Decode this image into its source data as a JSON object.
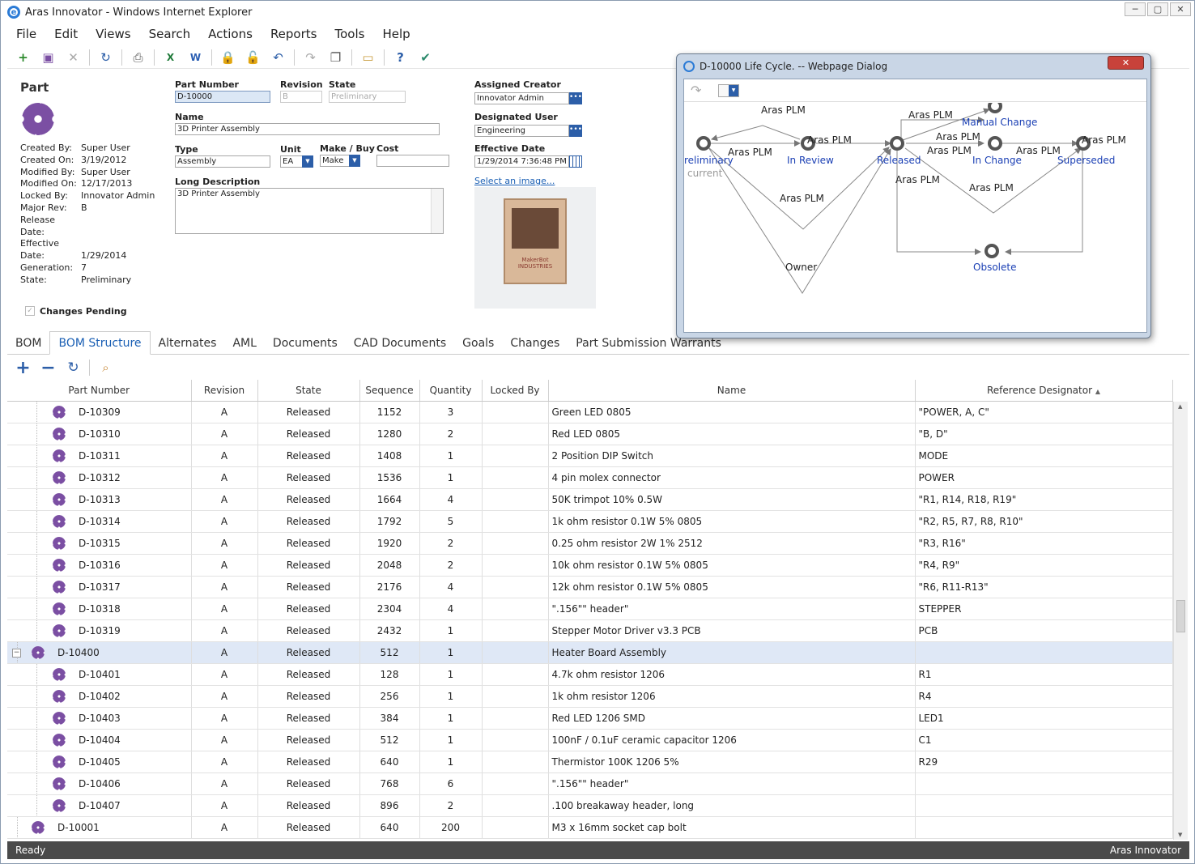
{
  "window": {
    "title": "Aras Innovator - Windows Internet Explorer"
  },
  "menu": [
    "File",
    "Edit",
    "Views",
    "Search",
    "Actions",
    "Reports",
    "Tools",
    "Help"
  ],
  "form": {
    "item_type": "Part",
    "meta": [
      {
        "k": "Created By:",
        "v": "Super User"
      },
      {
        "k": "Created On:",
        "v": "3/19/2012"
      },
      {
        "k": "Modified By:",
        "v": "Super User"
      },
      {
        "k": "Modified On:",
        "v": "12/17/2013"
      },
      {
        "k": "Locked By:",
        "v": "Innovator Admin"
      },
      {
        "k": "Major Rev:",
        "v": "B"
      },
      {
        "k": "Release Date:",
        "v": ""
      },
      {
        "k": "Effective Date:",
        "v": "1/29/2014"
      },
      {
        "k": "Generation:",
        "v": "7"
      },
      {
        "k": "State:",
        "v": "Preliminary"
      }
    ],
    "part_number_label": "Part Number",
    "part_number": "D-10000",
    "revision_label": "Revision",
    "revision": "B",
    "state_label": "State",
    "state": "Preliminary",
    "name_label": "Name",
    "name": "3D Printer Assembly",
    "type_label": "Type",
    "type": "Assembly",
    "unit_label": "Unit",
    "unit": "EA",
    "makebuy_label": "Make / Buy",
    "makebuy": "Make",
    "cost_label": "Cost",
    "cost": "",
    "longdesc_label": "Long Description",
    "longdesc": "3D Printer Assembly",
    "creator_label": "Assigned Creator",
    "creator": "Innovator Admin",
    "designated_label": "Designated User",
    "designated": "Engineering",
    "effdate_label": "Effective Date",
    "effdate": "1/29/2014 7:36:48 PM",
    "select_image": "Select an image...",
    "changes_pending": "Changes Pending",
    "image_text": "MakerBot INDUSTRIES"
  },
  "tabs": [
    "BOM",
    "BOM Structure",
    "Alternates",
    "AML",
    "Documents",
    "CAD Documents",
    "Goals",
    "Changes",
    "Part Submission Warrants"
  ],
  "grid": {
    "columns": [
      "Part Number",
      "Revision",
      "State",
      "Sequence",
      "Quantity",
      "Locked By",
      "Name",
      "Reference Designator"
    ],
    "sort_indicator": "▲",
    "rows": [
      {
        "lvl": 2,
        "pn": "D-10309",
        "rev": "A",
        "state": "Released",
        "seq": "1152",
        "qty": "3",
        "locked": "",
        "name": "Green LED 0805",
        "ref": "\"POWER, A, C\""
      },
      {
        "lvl": 2,
        "pn": "D-10310",
        "rev": "A",
        "state": "Released",
        "seq": "1280",
        "qty": "2",
        "locked": "",
        "name": "Red LED 0805",
        "ref": "\"B, D\""
      },
      {
        "lvl": 2,
        "pn": "D-10311",
        "rev": "A",
        "state": "Released",
        "seq": "1408",
        "qty": "1",
        "locked": "",
        "name": "2 Position DIP Switch",
        "ref": "MODE"
      },
      {
        "lvl": 2,
        "pn": "D-10312",
        "rev": "A",
        "state": "Released",
        "seq": "1536",
        "qty": "1",
        "locked": "",
        "name": "4 pin molex connector",
        "ref": "POWER"
      },
      {
        "lvl": 2,
        "pn": "D-10313",
        "rev": "A",
        "state": "Released",
        "seq": "1664",
        "qty": "4",
        "locked": "",
        "name": "50K trimpot 10% 0.5W",
        "ref": "\"R1, R14, R18, R19\""
      },
      {
        "lvl": 2,
        "pn": "D-10314",
        "rev": "A",
        "state": "Released",
        "seq": "1792",
        "qty": "5",
        "locked": "",
        "name": "1k ohm resistor 0.1W 5% 0805",
        "ref": "\"R2, R5, R7, R8, R10\""
      },
      {
        "lvl": 2,
        "pn": "D-10315",
        "rev": "A",
        "state": "Released",
        "seq": "1920",
        "qty": "2",
        "locked": "",
        "name": "0.25 ohm resistor 2W 1% 2512",
        "ref": "\"R3, R16\""
      },
      {
        "lvl": 2,
        "pn": "D-10316",
        "rev": "A",
        "state": "Released",
        "seq": "2048",
        "qty": "2",
        "locked": "",
        "name": "10k ohm resistor 0.1W 5% 0805",
        "ref": "\"R4, R9\""
      },
      {
        "lvl": 2,
        "pn": "D-10317",
        "rev": "A",
        "state": "Released",
        "seq": "2176",
        "qty": "4",
        "locked": "",
        "name": "12k ohm resistor 0.1W 5% 0805",
        "ref": "\"R6, R11-R13\""
      },
      {
        "lvl": 2,
        "pn": "D-10318",
        "rev": "A",
        "state": "Released",
        "seq": "2304",
        "qty": "4",
        "locked": "",
        "name": "\".156\"\" header\"",
        "ref": "STEPPER"
      },
      {
        "lvl": 2,
        "pn": "D-10319",
        "rev": "A",
        "state": "Released",
        "seq": "2432",
        "qty": "1",
        "locked": "",
        "name": "Stepper Motor Driver v3.3 PCB",
        "ref": "PCB"
      },
      {
        "lvl": 1,
        "pn": "D-10400",
        "rev": "A",
        "state": "Released",
        "seq": "512",
        "qty": "1",
        "locked": "",
        "name": "Heater Board Assembly",
        "ref": "",
        "sel": true,
        "expand": "−"
      },
      {
        "lvl": 2,
        "pn": "D-10401",
        "rev": "A",
        "state": "Released",
        "seq": "128",
        "qty": "1",
        "locked": "",
        "name": "4.7k ohm resistor 1206",
        "ref": "R1"
      },
      {
        "lvl": 2,
        "pn": "D-10402",
        "rev": "A",
        "state": "Released",
        "seq": "256",
        "qty": "1",
        "locked": "",
        "name": "1k ohm resistor 1206",
        "ref": "R4"
      },
      {
        "lvl": 2,
        "pn": "D-10403",
        "rev": "A",
        "state": "Released",
        "seq": "384",
        "qty": "1",
        "locked": "",
        "name": "Red LED 1206 SMD",
        "ref": "LED1"
      },
      {
        "lvl": 2,
        "pn": "D-10404",
        "rev": "A",
        "state": "Released",
        "seq": "512",
        "qty": "1",
        "locked": "",
        "name": "100nF / 0.1uF ceramic capacitor 1206",
        "ref": "C1"
      },
      {
        "lvl": 2,
        "pn": "D-10405",
        "rev": "A",
        "state": "Released",
        "seq": "640",
        "qty": "1",
        "locked": "",
        "name": "Thermistor 100K 1206 5%",
        "ref": "R29"
      },
      {
        "lvl": 2,
        "pn": "D-10406",
        "rev": "A",
        "state": "Released",
        "seq": "768",
        "qty": "6",
        "locked": "",
        "name": "\".156\"\" header\"",
        "ref": ""
      },
      {
        "lvl": 2,
        "pn": "D-10407",
        "rev": "A",
        "state": "Released",
        "seq": "896",
        "qty": "2",
        "locked": "",
        "name": ".100 breakaway header, long",
        "ref": ""
      },
      {
        "lvl": 1,
        "pn": "D-10001",
        "rev": "A",
        "state": "Released",
        "seq": "640",
        "qty": "200",
        "locked": "",
        "name": "M3 x 16mm socket cap bolt",
        "ref": ""
      }
    ]
  },
  "status": {
    "left": "Ready",
    "right": "Aras Innovator"
  },
  "dialog": {
    "title": "D-10000 Life Cycle. -- Webpage Dialog",
    "close": "✕",
    "states": [
      "reliminary",
      "In Review",
      "Released",
      "Manual Change",
      "In Change",
      "Superseded",
      "Obsolete"
    ],
    "current": "current",
    "transitions": [
      "Aras PLM",
      "Aras PLM",
      "Aras PLM",
      "Aras PLM",
      "Aras PLM",
      "Aras PLM",
      "Aras PLM",
      "Aras PLM",
      "Aras PLM",
      "Aras PLM",
      "Owner"
    ]
  }
}
